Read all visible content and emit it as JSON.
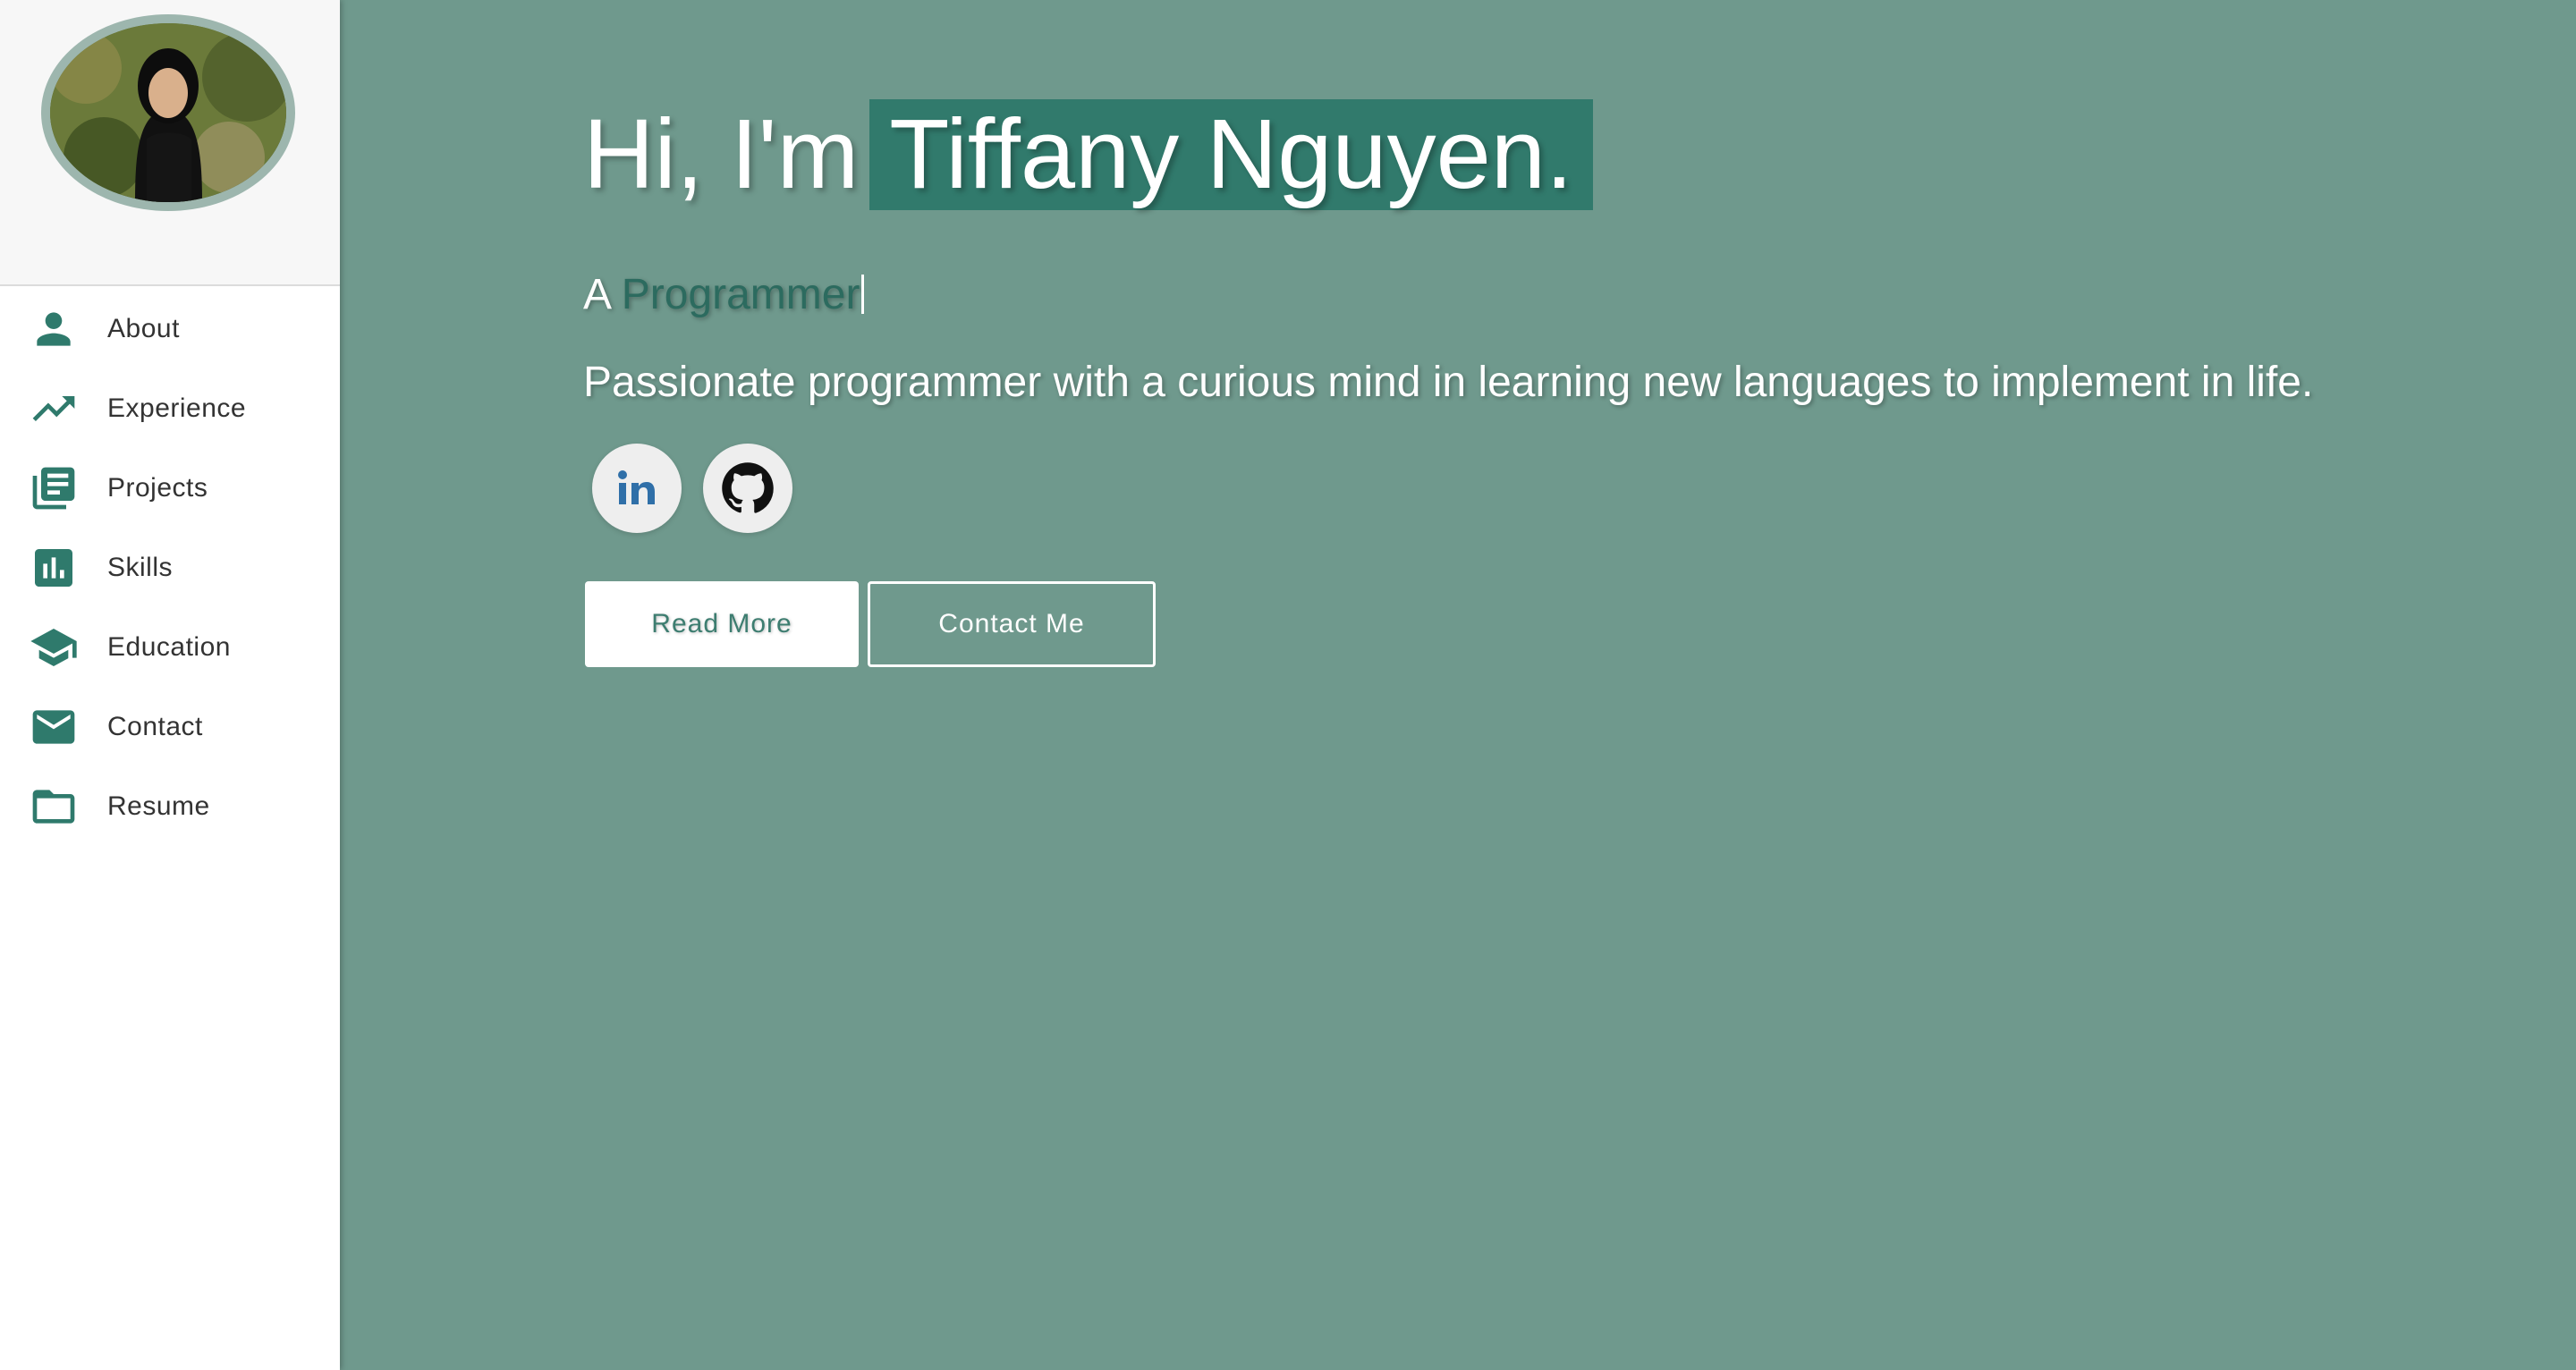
{
  "sidebar": {
    "avatar_alt": "Profile photo",
    "items": [
      {
        "label": "About",
        "icon": "person-icon"
      },
      {
        "label": "Experience",
        "icon": "trending-up-icon"
      },
      {
        "label": "Projects",
        "icon": "library-books-icon"
      },
      {
        "label": "Skills",
        "icon": "bar-chart-icon"
      },
      {
        "label": "Education",
        "icon": "graduation-cap-icon"
      },
      {
        "label": "Contact",
        "icon": "mail-icon"
      },
      {
        "label": "Resume",
        "icon": "folder-icon"
      }
    ]
  },
  "hero": {
    "greeting": "Hi, I'm",
    "name": "Tiffany Nguyen.",
    "subtitle_prefix": "A",
    "subtitle_role": "Programmer",
    "description": "Passionate programmer with a curious mind in learning new languages to implement in life."
  },
  "social": {
    "linkedin_icon": "linkedin-icon",
    "github_icon": "github-icon"
  },
  "buttons": {
    "read_more": "Read More",
    "contact_me": "Contact Me"
  },
  "colors": {
    "background": "#6f998d",
    "accent": "#317a6c",
    "icon": "#2f7a6c"
  }
}
